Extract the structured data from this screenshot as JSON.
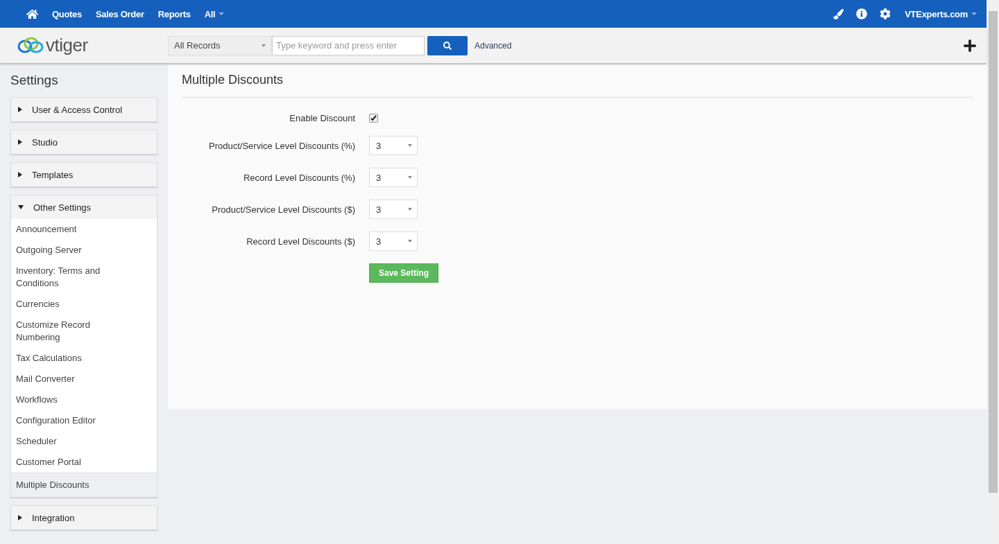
{
  "top_nav": {
    "items": [
      {
        "label": "Quotes",
        "dropdown": false
      },
      {
        "label": "Sales Order",
        "dropdown": false
      },
      {
        "label": "Reports",
        "dropdown": false
      },
      {
        "label": "All",
        "dropdown": true
      }
    ],
    "user": "VTExperts.com"
  },
  "header": {
    "logo": "vtiger",
    "search_scope": "All Records",
    "search": {
      "placeholder": "Type keyword and press enter"
    },
    "advanced": "Advanced"
  },
  "sidebar": {
    "title": "Settings",
    "groups": [
      {
        "label": "User & Access Control",
        "expanded": false
      },
      {
        "label": "Studio",
        "expanded": false
      },
      {
        "label": "Templates",
        "expanded": false
      },
      {
        "label": "Other Settings",
        "expanded": true,
        "items": [
          {
            "label": "Announcement",
            "selected": false
          },
          {
            "label": "Outgoing Server",
            "selected": false
          },
          {
            "label": "Inventory: Terms and Conditions",
            "selected": false
          },
          {
            "label": "Currencies",
            "selected": false
          },
          {
            "label": "Customize Record Numbering",
            "selected": false
          },
          {
            "label": "Tax Calculations",
            "selected": false
          },
          {
            "label": "Mail Converter",
            "selected": false
          },
          {
            "label": "Workflows",
            "selected": false
          },
          {
            "label": "Configuration Editor",
            "selected": false
          },
          {
            "label": "Scheduler",
            "selected": false
          },
          {
            "label": "Customer Portal",
            "selected": false
          },
          {
            "label": "Multiple Discounts",
            "selected": true
          }
        ]
      },
      {
        "label": "Integration",
        "expanded": false
      }
    ]
  },
  "main": {
    "title": "Multiple Discounts",
    "fields": [
      {
        "kind": "checkbox",
        "label": "Enable Discount",
        "checked": true
      },
      {
        "kind": "select",
        "label": "Product/Service Level Discounts (%)",
        "value": "3"
      },
      {
        "kind": "select",
        "label": "Record Level Discounts (%)",
        "value": "3"
      },
      {
        "kind": "select",
        "label": "Product/Service Level Discounts ($)",
        "value": "3"
      },
      {
        "kind": "select",
        "label": "Record Level Discounts ($)",
        "value": "3"
      }
    ],
    "save_button": "Save Setting"
  }
}
